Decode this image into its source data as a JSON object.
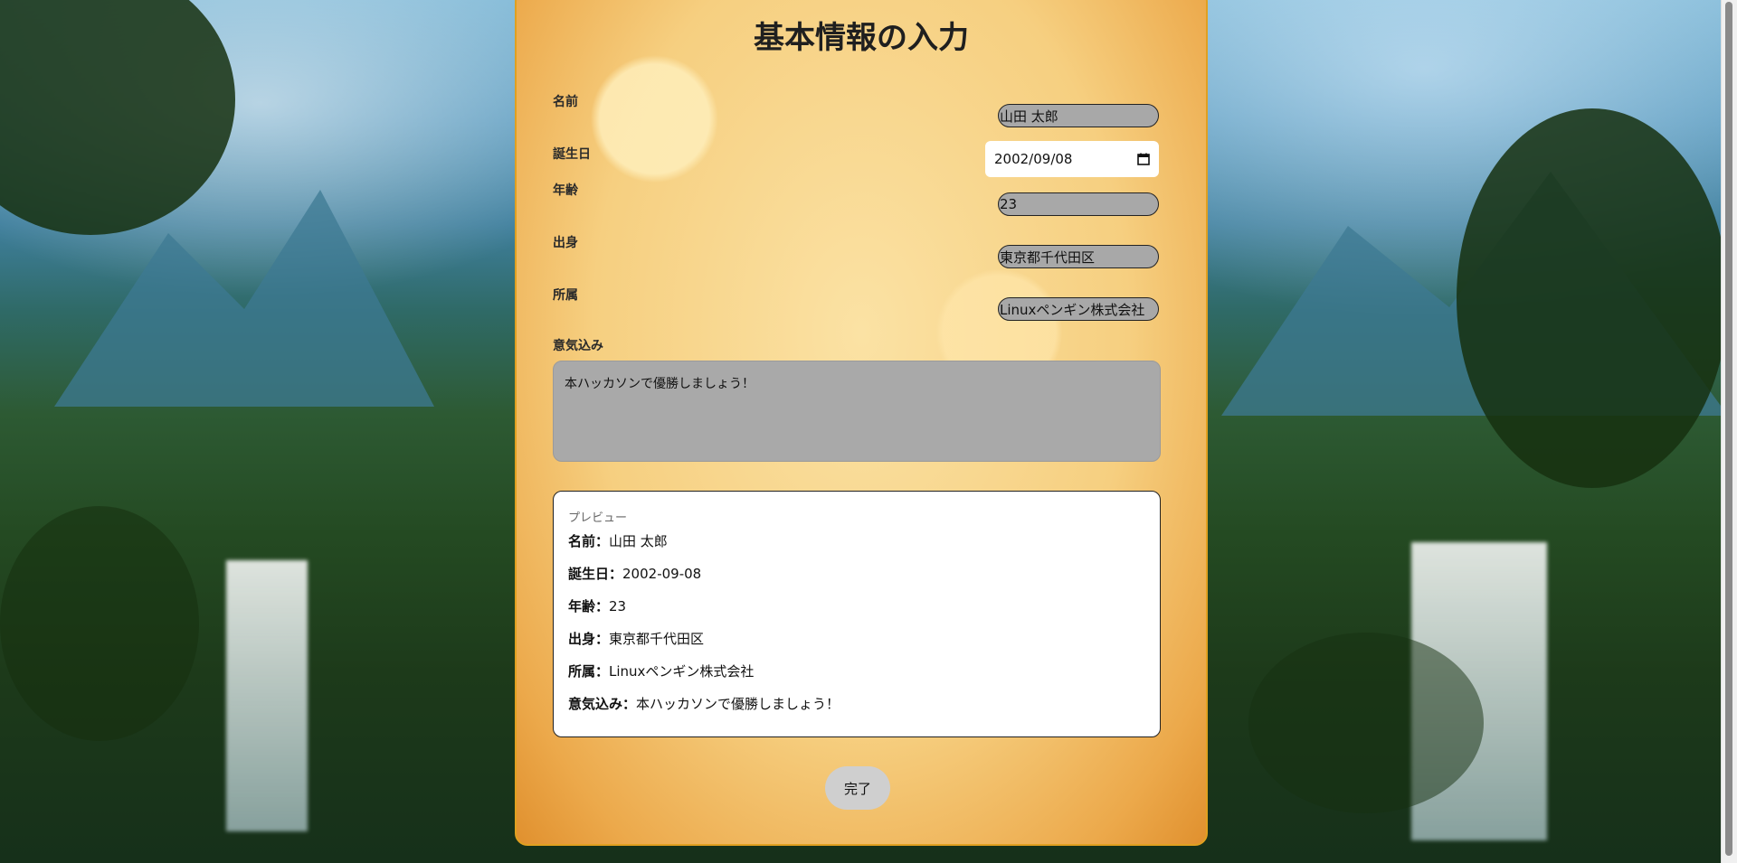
{
  "page": {
    "title": "基本情報の入力",
    "done_label": "完了"
  },
  "form": {
    "name_label": "名前",
    "name_value": "山田 太郎",
    "birthday_label": "誕生日",
    "birthday_value": "2002/09/08",
    "age_label": "年齢",
    "age_value": "23",
    "origin_label": "出身",
    "origin_value": "東京都千代田区",
    "affiliation_label": "所属",
    "affiliation_value": "Linuxペンギン株式会社",
    "motivation_label": "意気込み",
    "motivation_value": "本ハッカソンで優勝しましょう！"
  },
  "preview": {
    "heading": "プレビュー",
    "lines": [
      {
        "label": "名前：",
        "value": "山田 太郎"
      },
      {
        "label": "誕生日：",
        "value": "2002-09-08"
      },
      {
        "label": "年齢：",
        "value": "23"
      },
      {
        "label": "出身：",
        "value": "東京都千代田区"
      },
      {
        "label": "所属：",
        "value": "Linuxペンギン株式会社"
      },
      {
        "label": "意気込み：",
        "value": "本ハッカソンで優勝しましょう！"
      }
    ]
  },
  "icons": {
    "calendar": "calendar-icon"
  },
  "colors": {
    "panel_border": "#e0a020",
    "input_fill": "#a8a8a8",
    "button_fill": "#cfcfcf"
  }
}
